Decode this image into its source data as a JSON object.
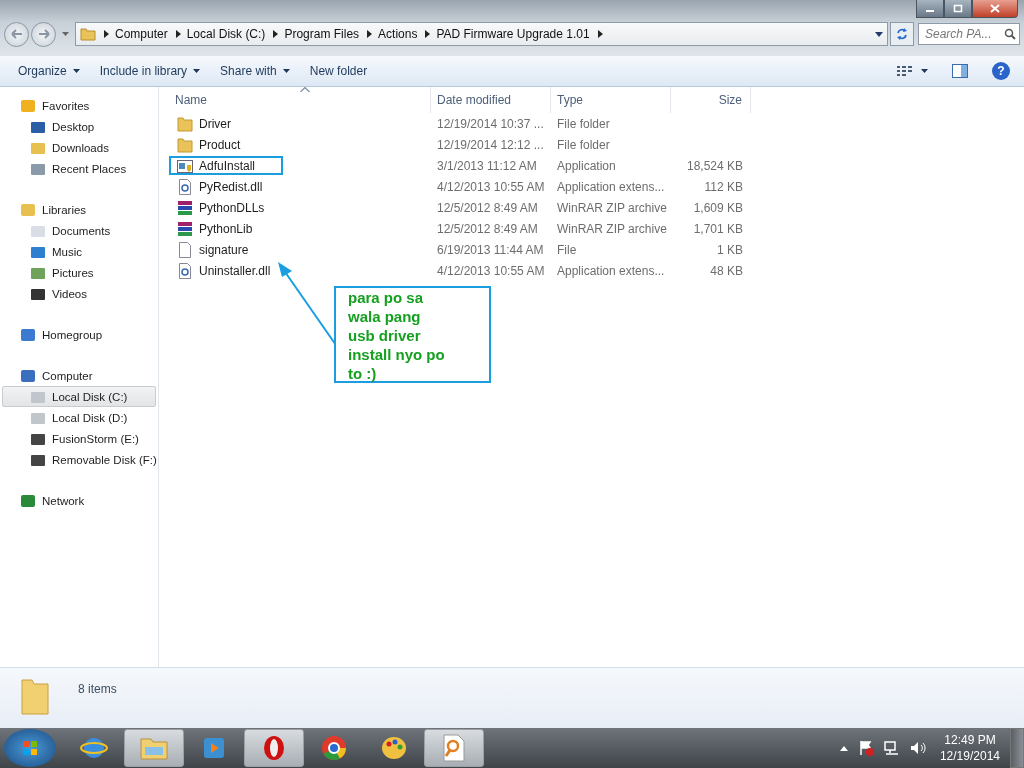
{
  "address_bar": {
    "crumbs": [
      "Computer",
      "Local Disk (C:)",
      "Program Files",
      "Actions",
      "PAD Firmware Upgrade 1.01"
    ],
    "search_placeholder": "Search PA..."
  },
  "toolbar": [
    {
      "label": "Organize",
      "dropdown": true
    },
    {
      "label": "Include in library",
      "dropdown": true
    },
    {
      "label": "Share with",
      "dropdown": true
    },
    {
      "label": "New folder",
      "dropdown": false
    }
  ],
  "navigation": [
    {
      "label": "Favorites",
      "kind": "favorites",
      "selected": false,
      "children": [
        {
          "label": "Desktop",
          "kind": "desktop",
          "selected": false
        },
        {
          "label": "Downloads",
          "kind": "downloads",
          "selected": false
        },
        {
          "label": "Recent Places",
          "kind": "recent",
          "selected": false
        }
      ]
    },
    {
      "label": "Libraries",
      "kind": "libraries",
      "selected": false,
      "children": [
        {
          "label": "Documents",
          "kind": "documents",
          "selected": false
        },
        {
          "label": "Music",
          "kind": "music",
          "selected": false
        },
        {
          "label": "Pictures",
          "kind": "pictures",
          "selected": false
        },
        {
          "label": "Videos",
          "kind": "videos",
          "selected": false
        }
      ]
    },
    {
      "label": "Homegroup",
      "kind": "homegroup",
      "selected": false
    },
    {
      "label": "Computer",
      "kind": "computer",
      "selected": false,
      "children": [
        {
          "label": "Local Disk (C:)",
          "kind": "sysdisk",
          "selected": true
        },
        {
          "label": "Local Disk (D:)",
          "kind": "disk",
          "selected": false
        },
        {
          "label": "FusionStorm (E:)",
          "kind": "removable",
          "selected": false
        },
        {
          "label": "Removable Disk (F:)",
          "kind": "removable",
          "selected": false
        }
      ]
    },
    {
      "label": "Network",
      "kind": "network",
      "selected": false
    }
  ],
  "help_label": "?",
  "table": {
    "columns": [
      {
        "label": "Name",
        "sorted": true
      },
      {
        "label": "Date modified",
        "sorted": false
      },
      {
        "label": "Type",
        "sorted": false
      },
      {
        "label": "Size",
        "sorted": false
      }
    ],
    "rows": [
      {
        "kind": "folder",
        "name": "Driver",
        "date": "12/19/2014 10:37 ...",
        "type": "File folder",
        "size": "",
        "outlined": false
      },
      {
        "kind": "folder",
        "name": "Product",
        "date": "12/19/2014 12:12 ...",
        "type": "File folder",
        "size": "",
        "outlined": false
      },
      {
        "kind": "app",
        "name": "AdfuInstall",
        "date": "3/1/2013 11:12 AM",
        "type": "Application",
        "size": "18,524 KB",
        "outlined": true
      },
      {
        "kind": "dll",
        "name": "PyRedist.dll",
        "date": "4/12/2013 10:55 AM",
        "type": "Application extens...",
        "size": "112 KB",
        "outlined": false
      },
      {
        "kind": "archive",
        "name": "PythonDLLs",
        "date": "12/5/2012 8:49 AM",
        "type": "WinRAR ZIP archive",
        "size": "1,609 KB",
        "outlined": false
      },
      {
        "kind": "archive",
        "name": "PythonLib",
        "date": "12/5/2012 8:49 AM",
        "type": "WinRAR ZIP archive",
        "size": "1,701 KB",
        "outlined": false
      },
      {
        "kind": "file",
        "name": "signature",
        "date": "6/19/2013 11:44 AM",
        "type": "File",
        "size": "1 KB",
        "outlined": false
      },
      {
        "kind": "dll",
        "name": "Uninstaller.dll",
        "date": "4/12/2013 10:55 AM",
        "type": "Application extens...",
        "size": "48 KB",
        "outlined": false
      }
    ]
  },
  "annotation": {
    "text": "para po sa wala pang usb driver install nyo po to :)"
  },
  "details_pane": {
    "count": "8 items"
  },
  "taskbar": {
    "apps": [
      {
        "kind": "ie",
        "open": false
      },
      {
        "kind": "explorer",
        "open": true
      },
      {
        "kind": "media",
        "open": false
      },
      {
        "kind": "opera",
        "open": true
      },
      {
        "kind": "chrome",
        "open": false
      },
      {
        "kind": "paint",
        "open": false
      },
      {
        "kind": "viewer",
        "open": true
      }
    ],
    "time": "12:49 PM",
    "date": "12/19/2014"
  }
}
